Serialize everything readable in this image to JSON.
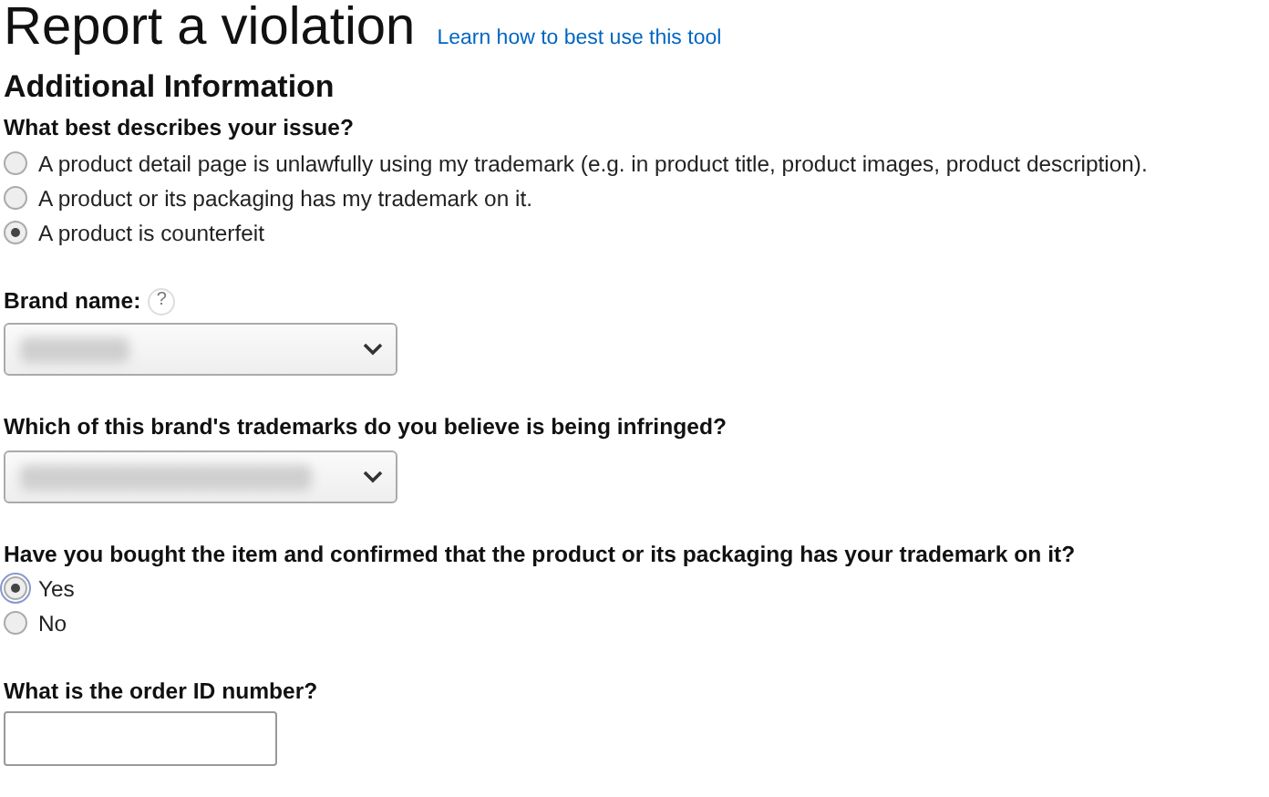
{
  "header": {
    "title": "Report a violation",
    "help_link": "Learn how to best use this tool"
  },
  "section_title": "Additional Information",
  "issue": {
    "label": "What best describes your issue?",
    "options": [
      {
        "label": "A product detail page is unlawfully using my trademark (e.g. in product title, product images, product description).",
        "selected": false
      },
      {
        "label": "A product or its packaging has my trademark on it.",
        "selected": false
      },
      {
        "label": "A product is counterfeit",
        "selected": true
      }
    ]
  },
  "brand": {
    "label": "Brand name:",
    "help": "?"
  },
  "trademark": {
    "label": "Which of this brand's trademarks do you believe is being infringed?"
  },
  "bought": {
    "label": "Have you bought the item and confirmed that the product or its packaging has your trademark on it?",
    "options": [
      {
        "label": "Yes",
        "selected": true,
        "focused": true
      },
      {
        "label": "No",
        "selected": false,
        "focused": false
      }
    ]
  },
  "order": {
    "label": "What is the order ID number?"
  }
}
